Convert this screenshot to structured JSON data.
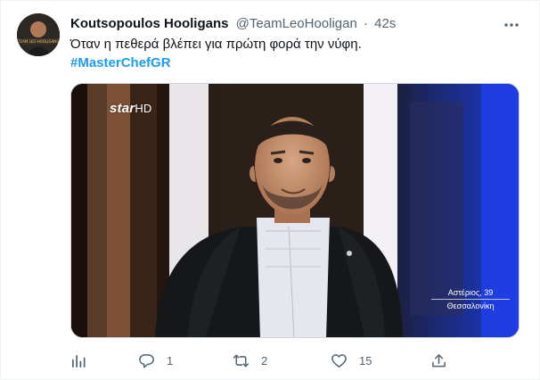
{
  "tweet": {
    "display_name": "Koutsopoulos Hooligans",
    "handle": "@TeamLeoHooligan",
    "separator": "·",
    "time": "42s",
    "text": "Όταν η πεθερά βλέπει για πρώτη φορά την νύφη.",
    "hashtag": "#MasterChefGR",
    "avatar_text": "TEAM LEO HOOLIGANS"
  },
  "media": {
    "channel_logo": "star",
    "channel_logo_suffix": "HD",
    "caption_line1": "Αστέριος, 39",
    "caption_line2": "Θεσσαλονίκη"
  },
  "actions": {
    "analytics_icon": "bar-chart-icon",
    "reply_icon": "speech-bubble-icon",
    "reply_count": "1",
    "retweet_icon": "retweet-arrows-icon",
    "retweet_count": "2",
    "like_icon": "heart-icon",
    "like_count": "15",
    "share_icon": "share-arrow-icon"
  },
  "colors": {
    "link": "#1d9bf0",
    "secondary_text": "#536471",
    "primary_text": "#0f1419"
  }
}
